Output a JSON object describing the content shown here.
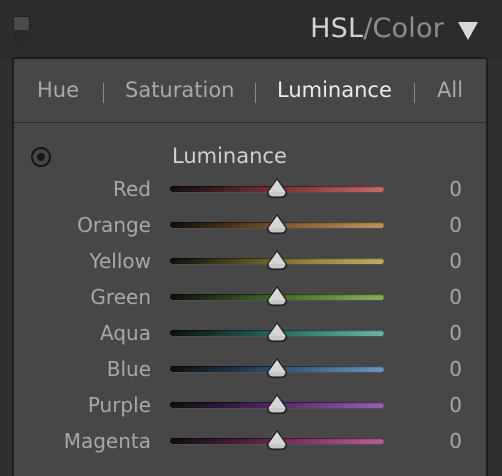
{
  "header": {
    "title_main": "HSL",
    "title_sep": "/",
    "title_alt": "Color"
  },
  "tabs": [
    {
      "label": "Hue",
      "active": false
    },
    {
      "label": "Saturation",
      "active": false
    },
    {
      "label": "Luminance",
      "active": true
    },
    {
      "label": "All",
      "active": false
    }
  ],
  "section": {
    "title": "Luminance"
  },
  "sliders": [
    {
      "label": "Red",
      "value": "0",
      "level": 0.5,
      "gradient": [
        "#0e0e0e",
        "#5c2828",
        "#8a3a3a",
        "#c96a6a"
      ]
    },
    {
      "label": "Orange",
      "value": "0",
      "level": 0.5,
      "gradient": [
        "#0e0e0e",
        "#5a3a1c",
        "#8a6234",
        "#c0925a"
      ]
    },
    {
      "label": "Yellow",
      "value": "0",
      "level": 0.5,
      "gradient": [
        "#0e0e0e",
        "#56501e",
        "#8a7c3a",
        "#c0ae66"
      ]
    },
    {
      "label": "Green",
      "value": "0",
      "level": 0.5,
      "gradient": [
        "#0e0e0e",
        "#2e5020",
        "#4f7a32",
        "#86b05a"
      ]
    },
    {
      "label": "Aqua",
      "value": "0",
      "level": 0.5,
      "gradient": [
        "#0e0e0e",
        "#1c4e46",
        "#327a6e",
        "#6cb6a8"
      ]
    },
    {
      "label": "Blue",
      "value": "0",
      "level": 0.5,
      "gradient": [
        "#0e0e0e",
        "#243a54",
        "#3a5e82",
        "#6a96c0"
      ]
    },
    {
      "label": "Purple",
      "value": "0",
      "level": 0.5,
      "gradient": [
        "#0e0e0e",
        "#3e1e4e",
        "#64327a",
        "#9a60b4"
      ]
    },
    {
      "label": "Magenta",
      "value": "0",
      "level": 0.5,
      "gradient": [
        "#0e0e0e",
        "#4e1c40",
        "#7c3266",
        "#b8609a"
      ]
    }
  ],
  "icons": {
    "panel_toggle": "panel-toggle-icon",
    "panel_arrow": "disclosure-triangle-icon",
    "target_adjustment": "target-adjustment-icon"
  }
}
